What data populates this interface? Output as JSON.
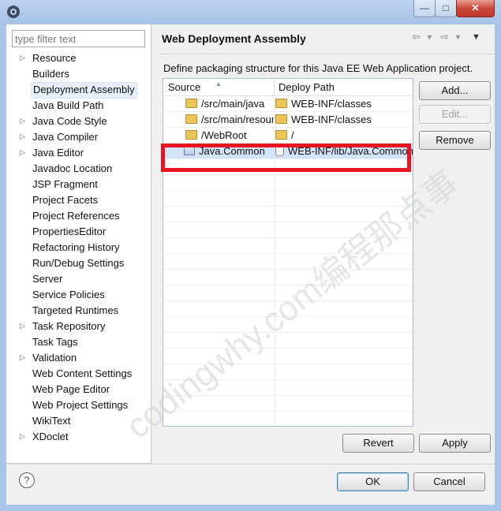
{
  "window": {
    "minimize_label": "—",
    "maximize_label": "□",
    "close_label": "✕"
  },
  "filter": {
    "placeholder": "type filter text"
  },
  "tree": {
    "items": [
      {
        "label": "Resource",
        "expandable": true
      },
      {
        "label": "Builders",
        "expandable": false
      },
      {
        "label": "Deployment Assembly",
        "expandable": false,
        "selected": true
      },
      {
        "label": "Java Build Path",
        "expandable": false
      },
      {
        "label": "Java Code Style",
        "expandable": true
      },
      {
        "label": "Java Compiler",
        "expandable": true
      },
      {
        "label": "Java Editor",
        "expandable": true
      },
      {
        "label": "Javadoc Location",
        "expandable": false
      },
      {
        "label": "JSP Fragment",
        "expandable": false
      },
      {
        "label": "Project Facets",
        "expandable": false
      },
      {
        "label": "Project References",
        "expandable": false
      },
      {
        "label": "PropertiesEditor",
        "expandable": false
      },
      {
        "label": "Refactoring History",
        "expandable": false
      },
      {
        "label": "Run/Debug Settings",
        "expandable": false
      },
      {
        "label": "Server",
        "expandable": false
      },
      {
        "label": "Service Policies",
        "expandable": false
      },
      {
        "label": "Targeted Runtimes",
        "expandable": false
      },
      {
        "label": "Task Repository",
        "expandable": true
      },
      {
        "label": "Task Tags",
        "expandable": false
      },
      {
        "label": "Validation",
        "expandable": true
      },
      {
        "label": "Web Content Settings",
        "expandable": false
      },
      {
        "label": "Web Page Editor",
        "expandable": false
      },
      {
        "label": "Web Project Settings",
        "expandable": false
      },
      {
        "label": "WikiText",
        "expandable": false
      },
      {
        "label": "XDoclet",
        "expandable": true
      }
    ]
  },
  "page": {
    "title": "Web Deployment Assembly",
    "description": "Define packaging structure for this Java EE Web Application project."
  },
  "table": {
    "headers": {
      "source": "Source",
      "deploy": "Deploy Path"
    },
    "rows": [
      {
        "source": "/src/main/java",
        "deploy": "WEB-INF/classes",
        "icon": "folder"
      },
      {
        "source": "/src/main/resources",
        "deploy": "WEB-INF/classes",
        "icon": "folder"
      },
      {
        "source": "/WebRoot",
        "deploy": "/",
        "icon": "folder"
      },
      {
        "source": "Java.Common",
        "deploy": "WEB-INF/lib/Java.Common.jar",
        "icon": "project",
        "selected": true
      }
    ]
  },
  "buttons": {
    "add": "Add...",
    "edit": "Edit...",
    "remove": "Remove",
    "revert": "Revert",
    "apply": "Apply",
    "ok": "OK",
    "cancel": "Cancel"
  },
  "help": "?",
  "watermark": "codingwhy.com编程那点事",
  "colors": {
    "highlight_box": "#e8141f",
    "selection": "#d3e4f8"
  }
}
